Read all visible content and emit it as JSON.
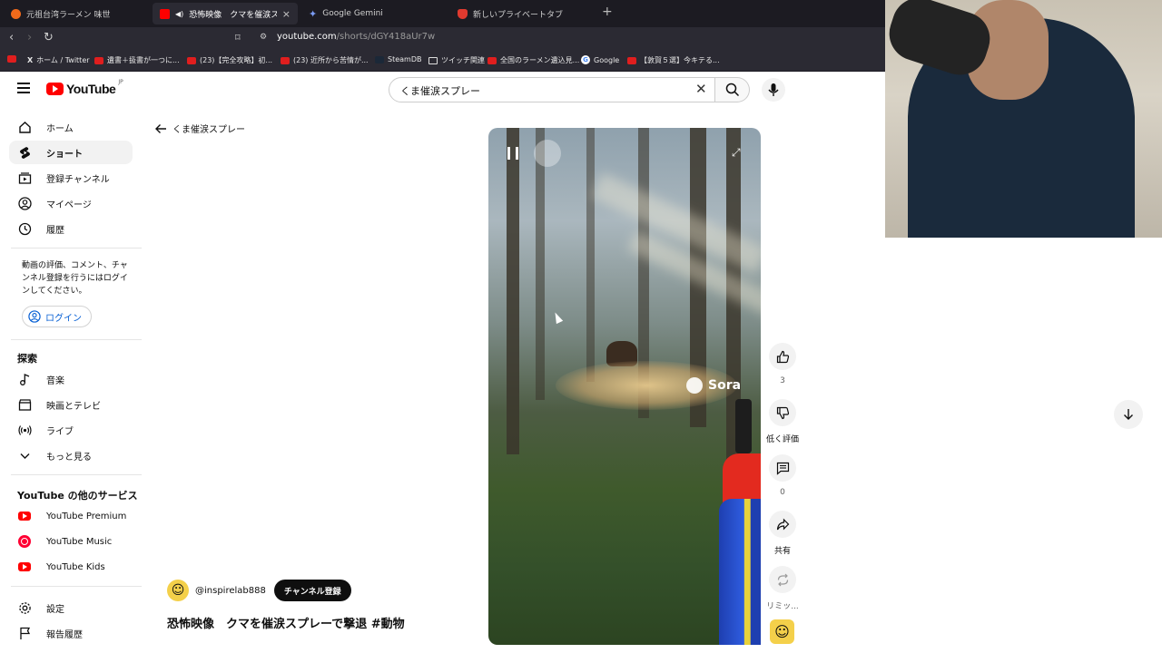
{
  "browser": {
    "tabs": [
      {
        "title": "元祖台湾ラーメン 味世",
        "favicon_color": "#f26a1b"
      },
      {
        "title": "恐怖映像　クマを催涙スプレーで",
        "favicon_color": "#ff0000"
      },
      {
        "title": "Google Gemini",
        "favicon_color": "#7b9cf5"
      },
      {
        "title": "新しいプライベートタブ",
        "favicon_color": "#e03a2f"
      }
    ],
    "url_host": "youtube.com",
    "url_path": "/shorts/dGY418aUr7w",
    "bookmarks": [
      "",
      "ホーム / Twitter",
      "遺書＋扱書が一つに...",
      "(23)【完全攻略】初...",
      "(23) 近所から苦情が...",
      "SteamDB",
      "ツイッチ関連",
      "全国のラーメン遺込見...",
      "Google",
      "【敦賀５選】今キテる..."
    ]
  },
  "header": {
    "logo_text": "YouTube",
    "region": "JP",
    "search_value": "くま催涙スプレー"
  },
  "sidebar": {
    "items": [
      {
        "label": "ホーム",
        "icon": "home-icon"
      },
      {
        "label": "ショート",
        "icon": "shorts-icon"
      },
      {
        "label": "登録チャンネル",
        "icon": "subscriptions-icon"
      },
      {
        "label": "マイページ",
        "icon": "account-icon"
      },
      {
        "label": "履歴",
        "icon": "history-icon"
      }
    ],
    "signin_prompt": "動画の評価、コメント、チャンネル登録を行うにはログインしてください。",
    "login_label": "ログイン",
    "explore_title": "探索",
    "explore_items": [
      {
        "label": "音楽",
        "icon": "music-icon"
      },
      {
        "label": "映画とテレビ",
        "icon": "movie-icon"
      },
      {
        "label": "ライブ",
        "icon": "live-icon"
      },
      {
        "label": "もっと見る",
        "icon": "chevron-down-icon"
      }
    ],
    "services_title": "YouTube の他のサービス",
    "services": [
      "YouTube Premium",
      "YouTube Music",
      "YouTube Kids"
    ],
    "footer_items": [
      {
        "label": "設定",
        "icon": "settings-icon"
      },
      {
        "label": "報告履歴",
        "icon": "flag-icon"
      }
    ]
  },
  "main": {
    "back_label": "くま催涙スプレー",
    "watermark": "Sora",
    "actions": {
      "like_count": "3",
      "dislike_label": "低く評価",
      "comment_count": "0",
      "share_label": "共有",
      "remix_label": "リミッ..."
    },
    "channel_handle": "@inspirelab888",
    "subscribe_label": "チャンネル登録",
    "video_title": "恐怖映像　クマを催涙スプレーで撃退 #動物"
  }
}
